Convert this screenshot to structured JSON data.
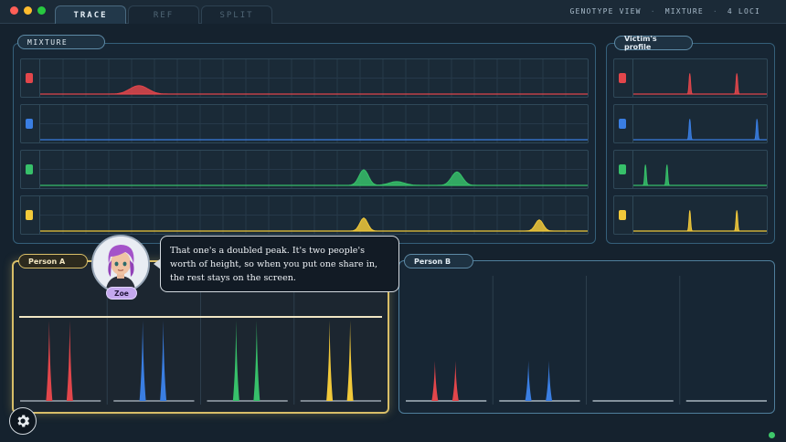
{
  "window": {
    "dots": [
      "#ff5f57",
      "#febc2e",
      "#28c840"
    ]
  },
  "tabs": [
    {
      "label": "TRACE",
      "active": true
    },
    {
      "label": "REF",
      "active": false
    },
    {
      "label": "SPLIT",
      "active": false
    }
  ],
  "status": {
    "view": "GENOTYPE VIEW",
    "mode": "MIXTURE",
    "loci": "4 LOCI"
  },
  "mixture": {
    "label": "MIXTURE",
    "lanes": [
      {
        "color": "#e2464b",
        "peaks": [
          [
            0.17,
            0.08,
            0.02
          ],
          [
            0.18,
            0.1,
            0.02
          ],
          [
            0.19,
            0.08,
            0.02
          ]
        ]
      },
      {
        "color": "#3a7ee2",
        "peaks": []
      },
      {
        "color": "#37c06a",
        "peaks": [
          [
            0.59,
            0.42,
            0.012
          ],
          [
            0.65,
            0.1,
            0.02
          ],
          [
            0.76,
            0.36,
            0.014
          ]
        ]
      },
      {
        "color": "#f2c93a",
        "peaks": [
          [
            0.59,
            0.35,
            0.01
          ],
          [
            0.91,
            0.3,
            0.01
          ]
        ]
      }
    ]
  },
  "victim": {
    "label": "Victim's profile",
    "lanes": [
      {
        "color": "#e2464b",
        "peaks": [
          [
            0.42,
            0.55
          ],
          [
            0.77,
            0.55
          ]
        ]
      },
      {
        "color": "#3a7ee2",
        "peaks": [
          [
            0.42,
            0.55
          ],
          [
            0.92,
            0.55
          ]
        ]
      },
      {
        "color": "#37c06a",
        "peaks": [
          [
            0.09,
            0.55
          ],
          [
            0.25,
            0.55
          ]
        ]
      },
      {
        "color": "#f2c93a",
        "peaks": [
          [
            0.42,
            0.55
          ],
          [
            0.77,
            0.55
          ]
        ]
      }
    ]
  },
  "person_a": {
    "label": "Person A",
    "cols": [
      {
        "color": "#e2464b",
        "peaks": [
          0.38,
          0.6
        ]
      },
      {
        "color": "#3a7ee2",
        "peaks": [
          0.38,
          0.6
        ]
      },
      {
        "color": "#37c06a",
        "peaks": [
          0.38,
          0.6
        ]
      },
      {
        "color": "#f2c93a",
        "peaks": [
          0.38,
          0.6
        ]
      }
    ],
    "threshold": 0.6
  },
  "person_b": {
    "label": "Person B",
    "cols": [
      {
        "color": "#e2464b",
        "peaks": [
          0.38,
          0.6
        ]
      },
      {
        "color": "#3a7ee2",
        "peaks": [
          0.38,
          0.6
        ]
      },
      {
        "color": "#37c06a",
        "peaks": []
      },
      {
        "color": "#f2c93a",
        "peaks": []
      }
    ]
  },
  "dialogue": {
    "speaker": "Zoe",
    "text": "That one's a doubled peak. It's two people's worth of height, so when you put one share in, the rest stays on the screen."
  }
}
